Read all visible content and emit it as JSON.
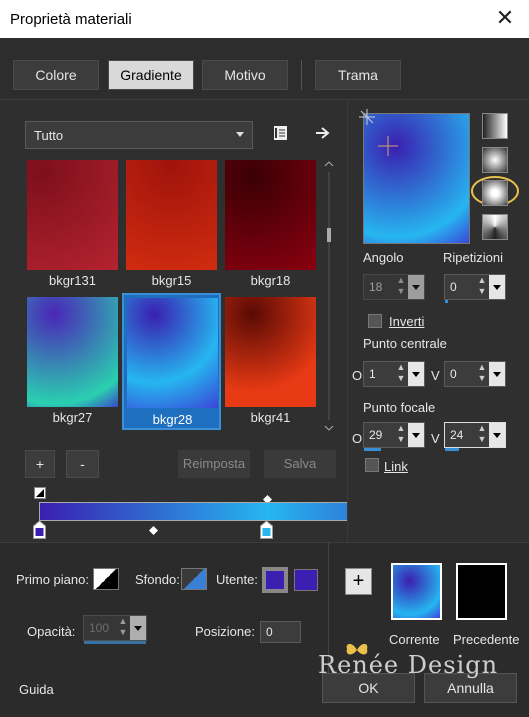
{
  "window": {
    "title": "Proprietà materiali",
    "close_glyph": "✕"
  },
  "tabs": [
    {
      "label": "Colore"
    },
    {
      "label": "Gradiente"
    },
    {
      "label": "Motivo"
    },
    {
      "label": "Trama"
    }
  ],
  "library": {
    "dropdown_value": "Tutto",
    "swatches": [
      {
        "label": "bkgr131",
        "colors": [
          "#7d0f1c",
          "#b5232f"
        ]
      },
      {
        "label": "bkgr15",
        "colors": [
          "#a0130b",
          "#d12c10"
        ]
      },
      {
        "label": "bkgr18",
        "colors": [
          "#4a0006",
          "#8a0010"
        ]
      },
      {
        "label": "bkgr27",
        "colors": [
          "#4a26b8",
          "#2ad0b0"
        ]
      },
      {
        "label": "bkgr28",
        "colors": [
          "#3a1fb0",
          "#26b6f0"
        ]
      },
      {
        "label": "bkgr41",
        "colors": [
          "#5a0a05",
          "#e83a14"
        ]
      }
    ],
    "add_label": "+",
    "remove_label": "-",
    "reset_label": "Reimposta",
    "save_label": "Salva"
  },
  "gradient": {
    "start_color": "#3a1fb0",
    "mid_color": "#26b6f0",
    "end_color": "#3a1fb0"
  },
  "properties": {
    "angle_label": "Angolo",
    "angle_value": "18",
    "repeats_label": "Ripetizioni",
    "repeats_value": "0",
    "invert_label": "Inverti",
    "center_label": "Punto centrale",
    "center_h_axis": "O",
    "center_h": "1",
    "center_v_axis": "V",
    "center_v": "0",
    "focal_label": "Punto focale",
    "focal_h_axis": "O",
    "focal_h": "29",
    "focal_v_axis": "V",
    "focal_v": "24",
    "link_label": "Link"
  },
  "bottom": {
    "foreground_label": "Primo piano:",
    "background_label": "Sfondo:",
    "user_label": "Utente:",
    "opacity_label": "Opacità:",
    "opacity_value": "100",
    "position_label": "Posizione:",
    "position_value": "0",
    "current_label": "Corrente",
    "previous_label": "Precedente",
    "add_label": "+",
    "help_label": "Guida",
    "ok_label": "OK",
    "cancel_label": "Annulla",
    "watermark": "Renée Design",
    "user_color": "#3a1fb0"
  }
}
